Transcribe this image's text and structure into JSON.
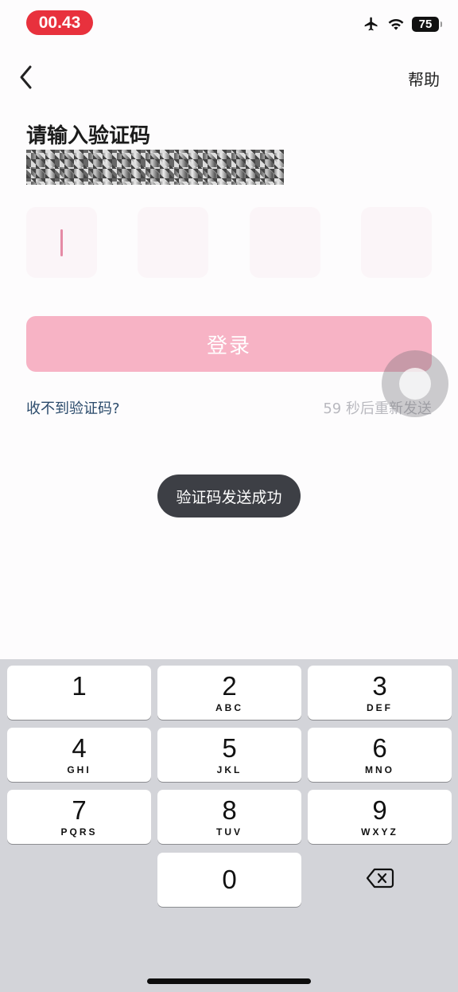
{
  "status_bar": {
    "time": "00.43",
    "battery": "75",
    "icons": [
      "airplane-icon",
      "wifi-icon",
      "battery-icon"
    ]
  },
  "nav": {
    "back_icon": "chevron-left-icon",
    "help_label": "帮助"
  },
  "verify": {
    "title": "请输入验证码",
    "code_boxes": [
      "",
      "",
      "",
      ""
    ],
    "login_label": "登录",
    "no_code_label": "收不到验证码?",
    "resend_label": "59 秒后重新发送"
  },
  "toast": {
    "message": "验证码发送成功"
  },
  "keypad": {
    "keys": [
      {
        "num": "1",
        "letters": ""
      },
      {
        "num": "2",
        "letters": "ABC"
      },
      {
        "num": "3",
        "letters": "DEF"
      },
      {
        "num": "4",
        "letters": "GHI"
      },
      {
        "num": "5",
        "letters": "JKL"
      },
      {
        "num": "6",
        "letters": "MNO"
      },
      {
        "num": "7",
        "letters": "PQRS"
      },
      {
        "num": "8",
        "letters": "TUV"
      },
      {
        "num": "9",
        "letters": "WXYZ"
      },
      {
        "num": "0",
        "letters": ""
      }
    ],
    "delete_icon": "backspace-icon"
  },
  "colors": {
    "accent_pink": "#f7b3c5",
    "time_pill": "#e8313d",
    "link_blue": "#2a4a6b",
    "toast_bg": "#3d3f45"
  }
}
